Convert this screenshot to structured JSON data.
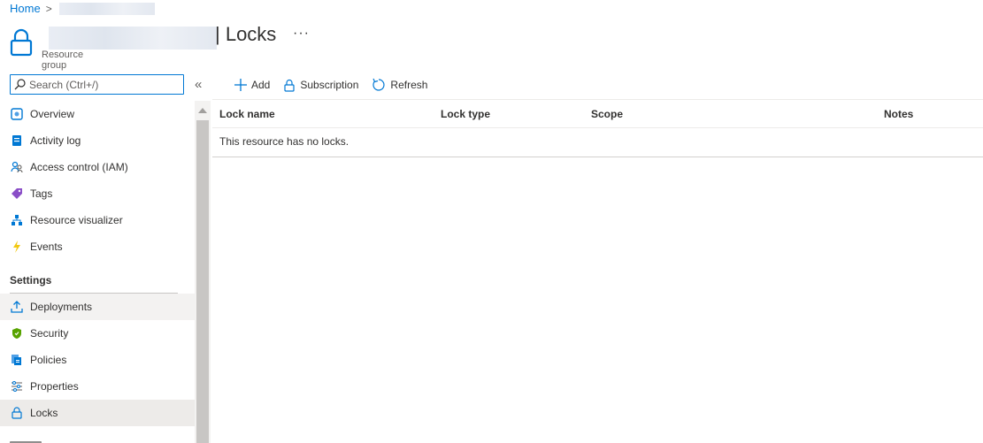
{
  "breadcrumb": {
    "home": "Home",
    "separator": ">"
  },
  "header": {
    "title": "| Locks",
    "subtitle": "Resource group",
    "more": "···"
  },
  "search": {
    "placeholder": "Search (Ctrl+/)"
  },
  "collapse_label": "«",
  "sidebar": {
    "items": [
      {
        "label": "Overview",
        "icon": "overview-icon"
      },
      {
        "label": "Activity log",
        "icon": "activity-log-icon"
      },
      {
        "label": "Access control (IAM)",
        "icon": "access-control-icon"
      },
      {
        "label": "Tags",
        "icon": "tag-icon"
      },
      {
        "label": "Resource visualizer",
        "icon": "resource-visualizer-icon"
      },
      {
        "label": "Events",
        "icon": "events-icon"
      }
    ],
    "settings_heading": "Settings",
    "settings_items": [
      {
        "label": "Deployments",
        "icon": "deployments-icon"
      },
      {
        "label": "Security",
        "icon": "security-icon"
      },
      {
        "label": "Policies",
        "icon": "policies-icon"
      },
      {
        "label": "Properties",
        "icon": "properties-icon"
      },
      {
        "label": "Locks",
        "icon": "lock-icon",
        "selected": true
      }
    ]
  },
  "toolbar": {
    "add": "Add",
    "subscription": "Subscription",
    "refresh": "Refresh"
  },
  "table": {
    "columns": [
      "Lock name",
      "Lock type",
      "Scope",
      "Notes"
    ],
    "empty_message": "This resource has no locks."
  },
  "colors": {
    "accent": "#0078d4",
    "text": "#323130",
    "selected_bg": "#edebe9"
  }
}
